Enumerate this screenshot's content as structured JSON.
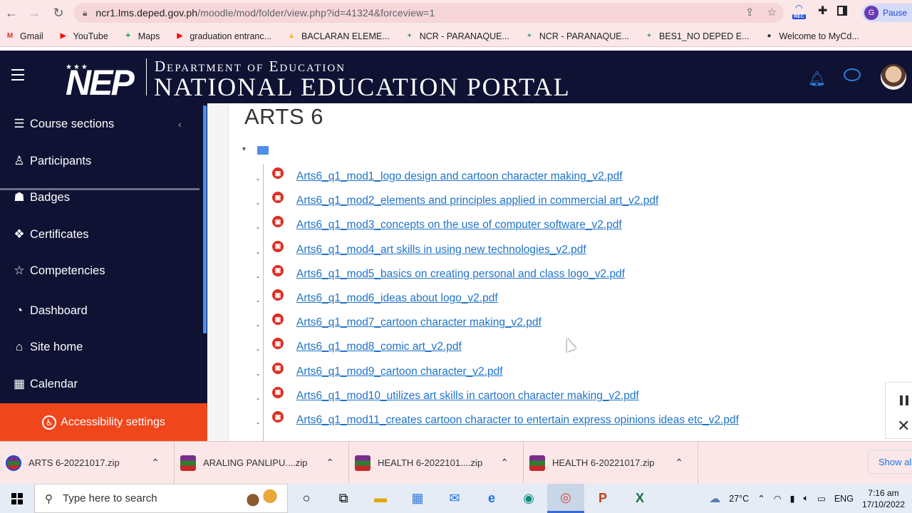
{
  "browser": {
    "url_host": "ncr1.lms.deped.gov.ph",
    "url_path": "/moodle/mod/folder/view.php?id=41324&forceview=1",
    "profile_label": "Pause",
    "profile_initial": "G",
    "rec_badge": "REC"
  },
  "bookmarks": [
    {
      "label": "Gmail",
      "icon": "gmail-icon",
      "color": "#d93025",
      "glyph": "M"
    },
    {
      "label": "YouTube",
      "icon": "youtube-icon",
      "color": "#ff0000",
      "glyph": "▶"
    },
    {
      "label": "Maps",
      "icon": "maps-icon",
      "color": "#34a853",
      "glyph": "✦"
    },
    {
      "label": "graduation entranc...",
      "icon": "youtube-icon",
      "color": "#ff0000",
      "glyph": "▶"
    },
    {
      "label": "BACLARAN ELEME...",
      "icon": "drive-icon",
      "color": "#fbbc04",
      "glyph": "▲"
    },
    {
      "label": "NCR - PARANAQUE...",
      "icon": "sheets-icon",
      "color": "#0f9d58",
      "glyph": "+"
    },
    {
      "label": "NCR - PARANAQUE...",
      "icon": "sheets-icon",
      "color": "#0f9d58",
      "glyph": "+"
    },
    {
      "label": "BES1_NO DEPED E...",
      "icon": "sheets-icon",
      "color": "#0f9d58",
      "glyph": "+"
    },
    {
      "label": "Welcome to MyCd...",
      "icon": "globe-icon",
      "color": "#333333",
      "glyph": "●"
    }
  ],
  "header": {
    "logo_text": "NEP",
    "logo_stars": "★★★",
    "dept_text": "Department of Education",
    "portal_text": "NATIONAL EDUCATION PORTAL"
  },
  "sidebar": {
    "items": [
      {
        "label": "Course sections",
        "icon": "list-icon",
        "glyph": "☰"
      },
      {
        "label": "Participants",
        "icon": "user-icon",
        "glyph": "♙"
      },
      {
        "label": "Badges",
        "icon": "badge-icon",
        "glyph": "☗"
      },
      {
        "label": "Certificates",
        "icon": "layers-icon",
        "glyph": "❖"
      },
      {
        "label": "Competencies",
        "icon": "star-icon",
        "glyph": "☆"
      },
      {
        "label": "Dashboard",
        "icon": "gauge-icon",
        "glyph": "◔"
      },
      {
        "label": "Site home",
        "icon": "home-icon",
        "glyph": "⌂"
      },
      {
        "label": "Calendar",
        "icon": "calendar-icon",
        "glyph": "▦"
      }
    ],
    "accessibility_label": "Accessibility settings"
  },
  "main": {
    "title": "ARTS 6",
    "files": [
      "Arts6_q1_mod1_logo design and cartoon character making_v2.pdf",
      "Arts6_q1_mod2_elements and principles applied in commercial art_v2.pdf",
      "Arts6_q1_mod3_concepts on the use of computer software_v2.pdf",
      "Arts6_q1_mod4_art skills in using new technologies_v2.pdf",
      "Arts6_q1_mod5_basics on creating personal and class logo_v2.pdf",
      "Arts6_q1_mod6_ideas about logo_v2.pdf",
      "Arts6_q1_mod7_cartoon character making_v2.pdf",
      "Arts6_q1_mod8_comic art_v2.pdf",
      "Arts6_q1_mod9_cartoon character_v2.pdf",
      "Arts6_q1_mod10_utilizes art skills in cartoon character making_v2.pdf",
      "Arts6_q1_mod11_creates cartoon character to entertain express opinions ideas etc_v2.pdf"
    ]
  },
  "downloads": {
    "items": [
      "ARTS 6-20221017.zip",
      "ARALING PANLIPU....zip",
      "HEALTH 6-2022101....zip",
      "HEALTH 6-20221017.zip"
    ],
    "show_all": "Show all"
  },
  "taskbar": {
    "search_placeholder": "Type here to search",
    "temperature": "27°C",
    "language": "ENG",
    "time": "7:16 am",
    "date": "17/10/2022"
  },
  "colors": {
    "header_bg": "#0f1233",
    "accent_orange": "#f0461c",
    "link_blue": "#1f73c9"
  }
}
